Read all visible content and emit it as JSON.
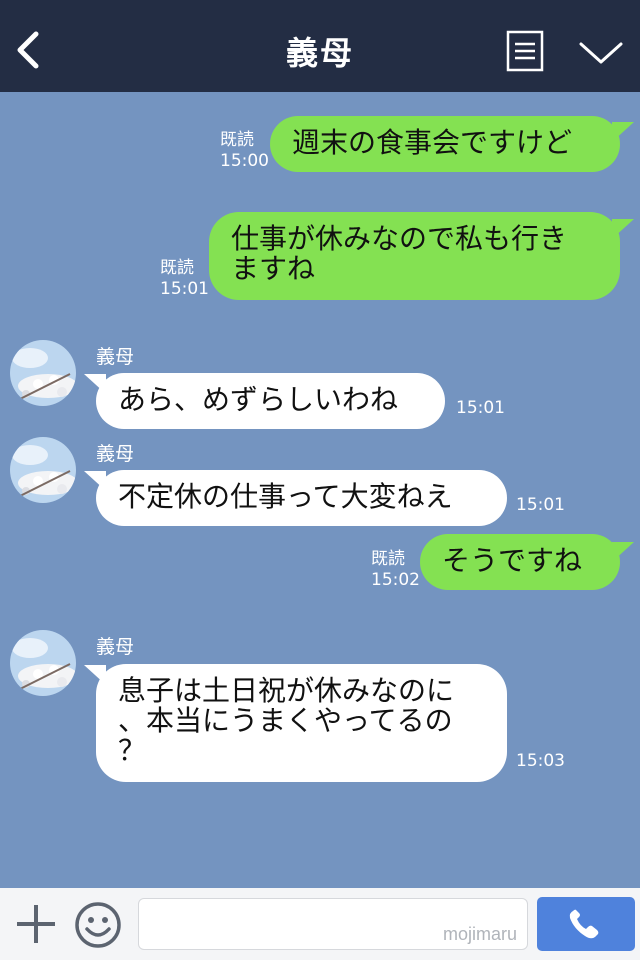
{
  "header": {
    "title": "義母"
  },
  "messages": [
    {
      "id": "m1",
      "direction": "out",
      "text": "週末の食事会ですけど",
      "read": "既読",
      "time": "15:00"
    },
    {
      "id": "m2",
      "direction": "out",
      "text": "仕事が休みなので私も行き\nますね",
      "read": "既読",
      "time": "15:01"
    },
    {
      "id": "m3",
      "direction": "in",
      "sender": "義母",
      "text": "あら、めずらしいわね",
      "time": "15:01"
    },
    {
      "id": "m4",
      "direction": "in",
      "sender": "義母",
      "text": "不定休の仕事って大変ねえ",
      "time": "15:01"
    },
    {
      "id": "m5",
      "direction": "out",
      "text": "そうですね",
      "read": "既読",
      "time": "15:02"
    },
    {
      "id": "m6",
      "direction": "in",
      "sender": "義母",
      "text": "息子は土日祝が休みなのに\n、本当にうまくやってるの\n？",
      "time": "15:03"
    }
  ],
  "footer": {
    "watermark": "mojimaru"
  },
  "icons": {
    "back": "chevron-left-icon",
    "menu": "document-icon",
    "collapse": "chevron-down-icon",
    "add": "plus-icon",
    "emoji": "smile-icon",
    "call": "phone-icon",
    "avatar": "sky-photo"
  },
  "colors": {
    "header": "#232d44",
    "background": "#7494c0",
    "outgoing": "#84e152",
    "incoming": "#ffffff",
    "call_button": "#4f82dc"
  }
}
